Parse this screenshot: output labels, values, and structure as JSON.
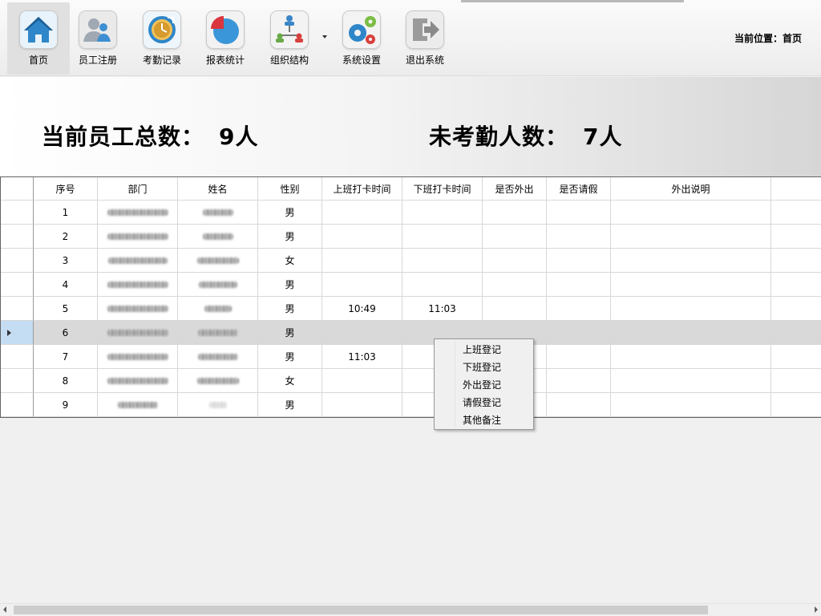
{
  "toolbar": {
    "items": [
      {
        "label": "首页",
        "icon": "home-icon",
        "active": true
      },
      {
        "label": "员工注册",
        "icon": "users-icon"
      },
      {
        "label": "考勤记录",
        "icon": "clock-icon"
      },
      {
        "label": "报表统计",
        "icon": "pie-chart-icon"
      },
      {
        "label": "组织结构",
        "icon": "org-chart-icon"
      },
      {
        "label": "系统设置",
        "icon": "gears-icon"
      },
      {
        "label": "退出系统",
        "icon": "exit-icon"
      }
    ],
    "location": "当前位置：首页"
  },
  "stats": {
    "total_label": "当前员工总数：",
    "total_value": "9人",
    "absent_label": "未考勤人数：",
    "absent_value": "7人"
  },
  "grid": {
    "columns": [
      "序号",
      "部门",
      "姓名",
      "性别",
      "上班打卡时间",
      "下班打卡时间",
      "是否外出",
      "是否请假",
      "外出说明"
    ],
    "rows": [
      {
        "no": "1",
        "gender": "男",
        "in": "",
        "out": ""
      },
      {
        "no": "2",
        "gender": "男",
        "in": "",
        "out": ""
      },
      {
        "no": "3",
        "gender": "女",
        "in": "",
        "out": ""
      },
      {
        "no": "4",
        "gender": "男",
        "in": "",
        "out": ""
      },
      {
        "no": "5",
        "gender": "男",
        "in": "10:49",
        "out": "11:03"
      },
      {
        "no": "6",
        "gender": "男",
        "in": "",
        "out": ""
      },
      {
        "no": "7",
        "gender": "男",
        "in": "11:03",
        "out": ""
      },
      {
        "no": "8",
        "gender": "女",
        "in": "",
        "out": ""
      },
      {
        "no": "9",
        "gender": "男",
        "in": "",
        "out": ""
      }
    ],
    "selected_row": 6
  },
  "context_menu": {
    "items": [
      "上班登记",
      "下班登记",
      "外出登记",
      "请假登记",
      "其他备注"
    ]
  },
  "colors": {
    "selected_row": "#d9d9d9",
    "row_header_selected": "#c4ddf3",
    "grid_line": "#d8d8d8"
  }
}
